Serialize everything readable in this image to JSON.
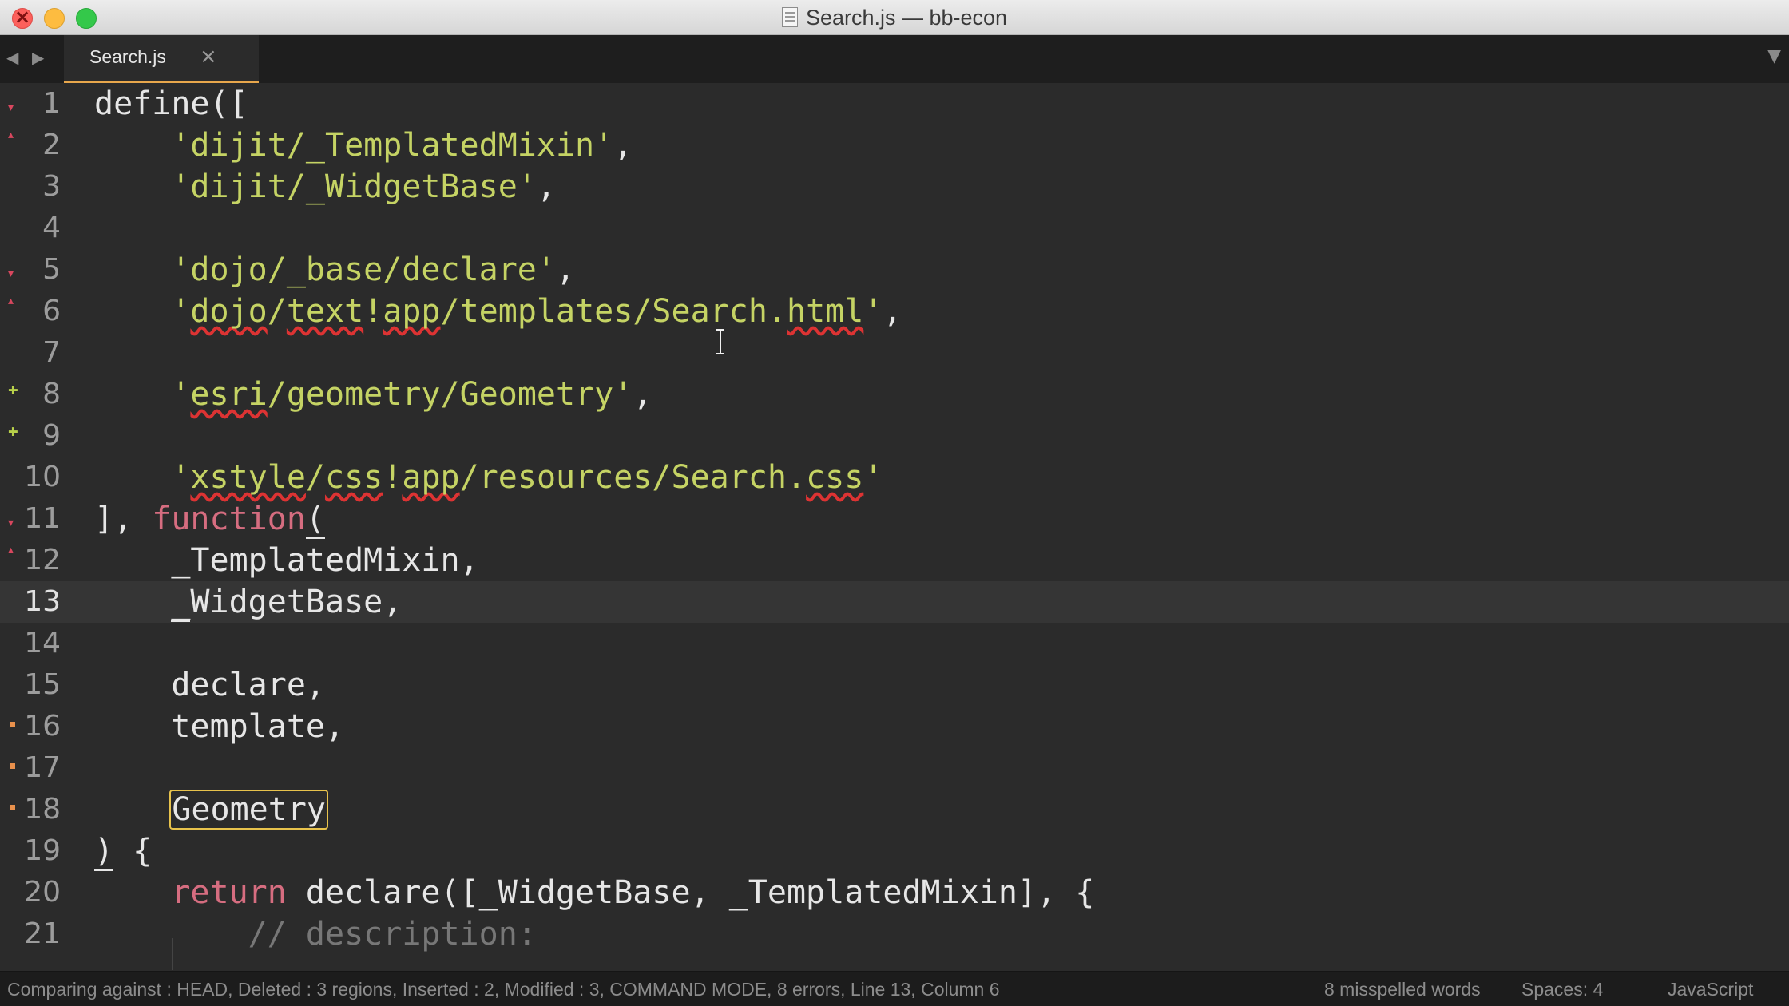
{
  "window": {
    "title": "Search.js — bb-econ"
  },
  "tabs": [
    {
      "label": "Search.js",
      "close": "×"
    }
  ],
  "nav": {
    "back": "◀",
    "forward": "▶",
    "dropdown": "▼"
  },
  "editor": {
    "current_line": 13,
    "lines": [
      {
        "no": "1"
      },
      {
        "no": "2"
      },
      {
        "no": "3"
      },
      {
        "no": "4"
      },
      {
        "no": "5"
      },
      {
        "no": "6"
      },
      {
        "no": "7"
      },
      {
        "no": "8"
      },
      {
        "no": "9"
      },
      {
        "no": "10"
      },
      {
        "no": "11"
      },
      {
        "no": "12"
      },
      {
        "no": "13"
      },
      {
        "no": "14"
      },
      {
        "no": "15"
      },
      {
        "no": "16"
      },
      {
        "no": "17"
      },
      {
        "no": "18"
      },
      {
        "no": "19"
      },
      {
        "no": "20"
      },
      {
        "no": "21"
      }
    ],
    "code": {
      "l1_a": "define([",
      "l2_str": "'dijit/_TemplatedMixin'",
      "l2_tail": ",",
      "l3_str": "'dijit/_WidgetBase'",
      "l3_tail": ",",
      "l5_str": "'dojo/_base/declare'",
      "l5_tail": ",",
      "l6_q1": "'",
      "l6_w1": "dojo",
      "l6_s1": "/",
      "l6_w2": "text",
      "l6_s2": "!",
      "l6_w3": "app",
      "l6_s3": "/templates/Search.",
      "l6_w4": "html",
      "l6_q2": "'",
      "l6_tail": ",",
      "l8_q1": "'",
      "l8_w1": "esri",
      "l8_rest": "/geometry/Geometry'",
      "l8_tail": ",",
      "l10_q1": "'",
      "l10_w1": "xstyle",
      "l10_s1": "/",
      "l10_w2": "css",
      "l10_s2": "!",
      "l10_w3": "app",
      "l10_s3": "/resources/Search.",
      "l10_w4": "css",
      "l10_q2": "'",
      "l11_a": "], ",
      "l11_kw": "function",
      "l11_b": "(",
      "l12": "_TemplatedMixin,",
      "l13_a": "_",
      "l13_b": "WidgetBase,",
      "l15": "declare,",
      "l16": "template,",
      "l18": "Geometry",
      "l19_a": ")",
      "l19_b": " {",
      "l20_kw": "return",
      "l20_rest": " declare([_WidgetBase, _TemplatedMixin], {",
      "l21_cmt": "// description:"
    }
  },
  "status": {
    "left": "Comparing against : HEAD, Deleted : 3 regions, Inserted : 2, Modified : 3, COMMAND MODE, 8 errors, Line 13, Column 6",
    "spelling": "8 misspelled words",
    "spaces": "Spaces: 4",
    "syntax": "JavaScript"
  }
}
